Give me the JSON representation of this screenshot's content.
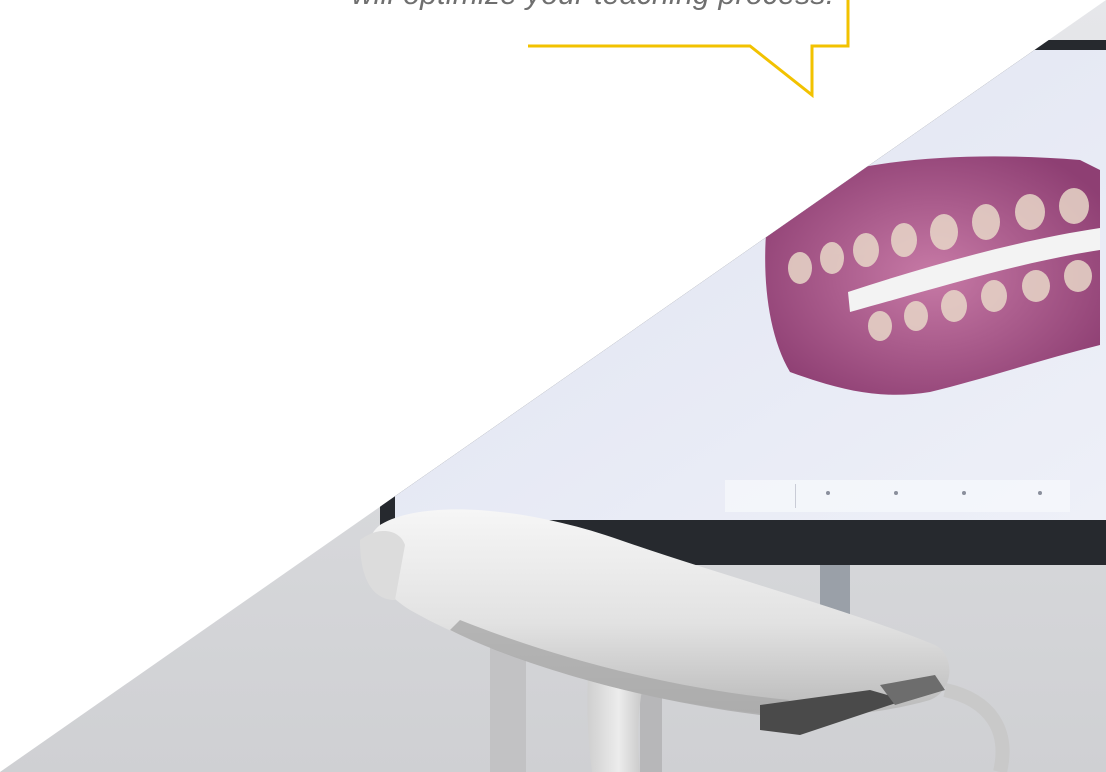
{
  "quote": {
    "text": "will optimize your teaching process."
  },
  "colors": {
    "accent": "#f2c200",
    "quote_text": "#6f6f6f",
    "background": "#ffffff"
  },
  "photo": {
    "subject": "intraoral-scanner-with-monitor-showing-3d-dental-scan"
  }
}
